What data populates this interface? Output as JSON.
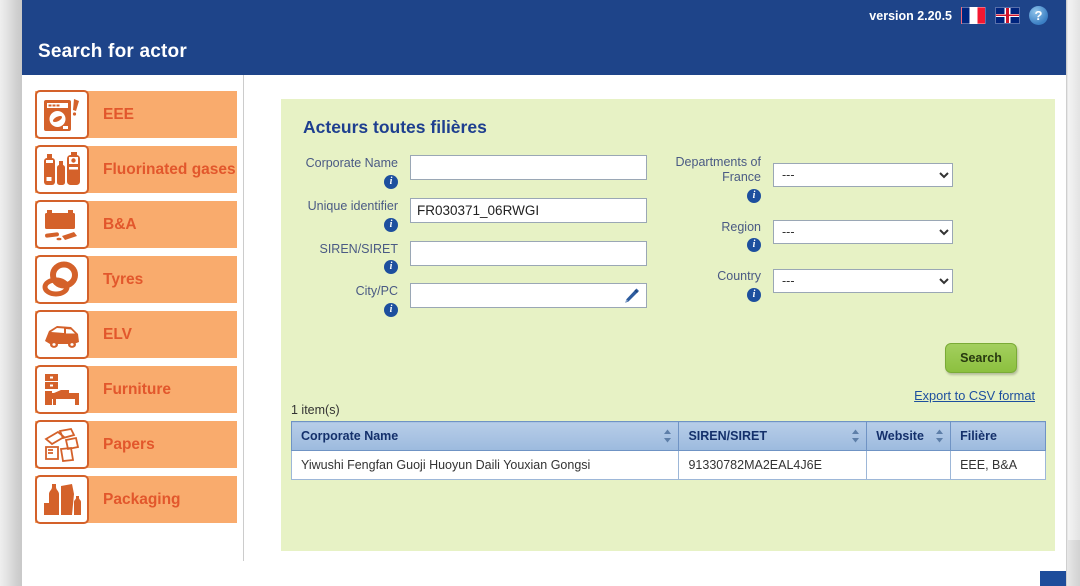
{
  "header": {
    "title": "Search for actor",
    "version": "version 2.20.5",
    "flag_fr": "flag-france-icon",
    "flag_uk": "flag-uk-icon",
    "help": "?"
  },
  "sidebar": {
    "items": [
      {
        "label": "EEE",
        "icon": "washing-machine-icon"
      },
      {
        "label": "Fluorinated gases",
        "icon": "gas-cylinders-icon"
      },
      {
        "label": "B&A",
        "icon": "battery-icon"
      },
      {
        "label": "Tyres",
        "icon": "tyre-icon"
      },
      {
        "label": "ELV",
        "icon": "car-icon"
      },
      {
        "label": "Furniture",
        "icon": "bed-furniture-icon"
      },
      {
        "label": "Papers",
        "icon": "papers-icon"
      },
      {
        "label": "Packaging",
        "icon": "packaging-bottles-icon"
      }
    ]
  },
  "panel": {
    "title": "Acteurs toutes filières",
    "form": {
      "left": [
        {
          "label": "Corporate Name",
          "value": "",
          "name": "corporate-name"
        },
        {
          "label": "Unique identifier",
          "value": "FR030371_06RWGI",
          "name": "unique-identifier"
        },
        {
          "label": "SIREN/SIRET",
          "value": "",
          "name": "siren-siret"
        },
        {
          "label": "City/PC",
          "value": "",
          "name": "city-pc"
        }
      ],
      "right": [
        {
          "label": "Departments of France",
          "value": "---",
          "name": "departments-of-france"
        },
        {
          "label": "Region",
          "value": "---",
          "name": "region"
        },
        {
          "label": "Country",
          "value": "---",
          "name": "country"
        }
      ]
    },
    "search_label": "Search",
    "export_label": "Export to CSV format",
    "item_count": "1 item(s)",
    "table": {
      "columns": [
        {
          "label": "Corporate Name",
          "sortable": true
        },
        {
          "label": "SIREN/SIRET",
          "sortable": true
        },
        {
          "label": "Website",
          "sortable": true
        },
        {
          "label": "Filière",
          "sortable": false
        }
      ],
      "rows": [
        {
          "corporate_name": "Yiwushi Fengfan Guoji Huoyun Daili Youxian Gongsi",
          "siren_siret": "91330782MA2EAL4J6E",
          "website": "",
          "filiere": "EEE, B&A"
        }
      ]
    }
  },
  "colors": {
    "header_blue": "#1e4489",
    "panel_green": "#e7f2c5",
    "nav_orange": "#f9ab6d",
    "nav_text": "#e2572c",
    "search_green": "#8cc03f",
    "link_blue": "#1d4f9e"
  }
}
